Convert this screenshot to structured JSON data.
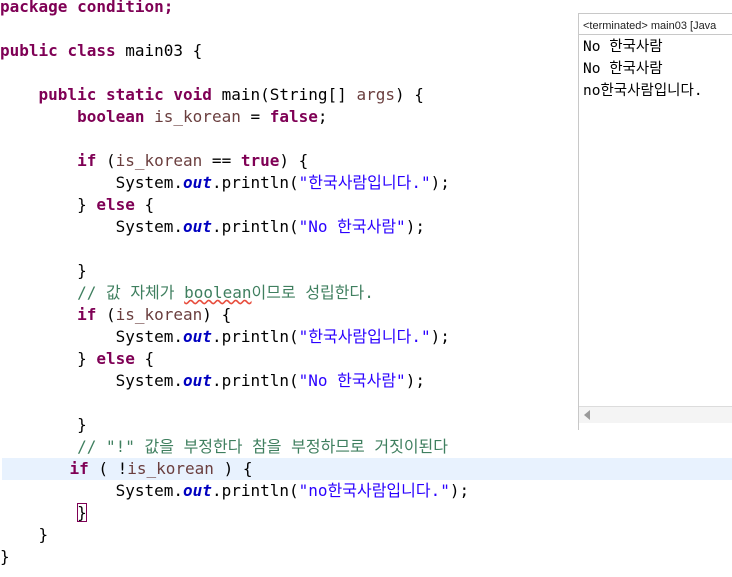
{
  "editor": {
    "line_package": "package condition;",
    "kw_public": "public",
    "kw_class": "class",
    "class_name": " main03 {",
    "kw_static": "static",
    "kw_void": "void",
    "main_sig_a": " main(String[] ",
    "args": "args",
    "main_sig_b": ") {",
    "kw_boolean": "boolean",
    "is_korean": "is_korean",
    "assign": " = ",
    "kw_false": "false",
    "semi": ";",
    "kw_if": "if",
    "if1_open": " (",
    "eq": " == ",
    "kw_true": "true",
    "close_brace_open": ") {",
    "system": "System.",
    "out": "out",
    "println_open": ".println(",
    "str_korean_person": "\"한국사람입니다.\"",
    "str_no_korean": "\"No 한국사람\"",
    "str_no_lower": "\"no한국사람입니다.\"",
    "println_close": ");",
    "brace_close": "}",
    "kw_else": "else",
    "brace_open": " {",
    "comment2_a": "// 값 자체가 ",
    "comment2_b": "boolean",
    "comment2_c": "이므로 성립한다.",
    "if2_open": " (",
    "if2_close": ") {",
    "comment3": "// \"!\" 값을 부정한다 참을 부정하므로 거짓이된다",
    "if3_open": " ( !",
    "if3_close": " ) {"
  },
  "console": {
    "header": "<terminated> main03 [Java",
    "lines": [
      "No 한국사람",
      "No 한국사람",
      "no한국사람입니다."
    ]
  }
}
